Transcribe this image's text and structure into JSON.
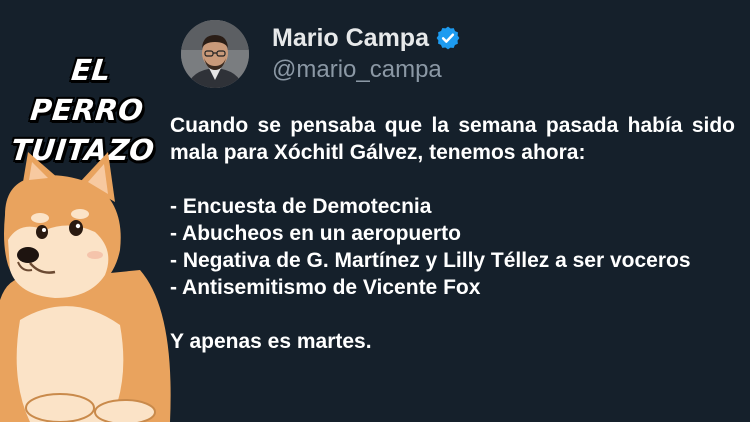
{
  "brand": {
    "line1": "EL PERRO",
    "line2": "TUITAZO"
  },
  "mascot": {
    "icon": "shiba-dog-icon"
  },
  "profile": {
    "display_name": "Mario Campa",
    "handle": "@mario_campa",
    "verified_icon": "verified-badge-icon",
    "verified_color": "#1d9bf0"
  },
  "tweet": {
    "paragraph1": "Cuando se pensaba que la semana pasada había sido mala para Xóchitl Gálvez, tenemos ahora:",
    "items": [
      "- Encuesta de Demotecnia",
      "- Abucheos en un aeropuerto",
      "- Negativa de G. Martínez y Lilly Téllez a ser voceros",
      "- Antisemitismo de Vicente Fox"
    ],
    "closing": "Y apenas es martes."
  },
  "colors": {
    "background": "#15202b",
    "text": "#ffffff",
    "handle": "#8b98a5"
  }
}
